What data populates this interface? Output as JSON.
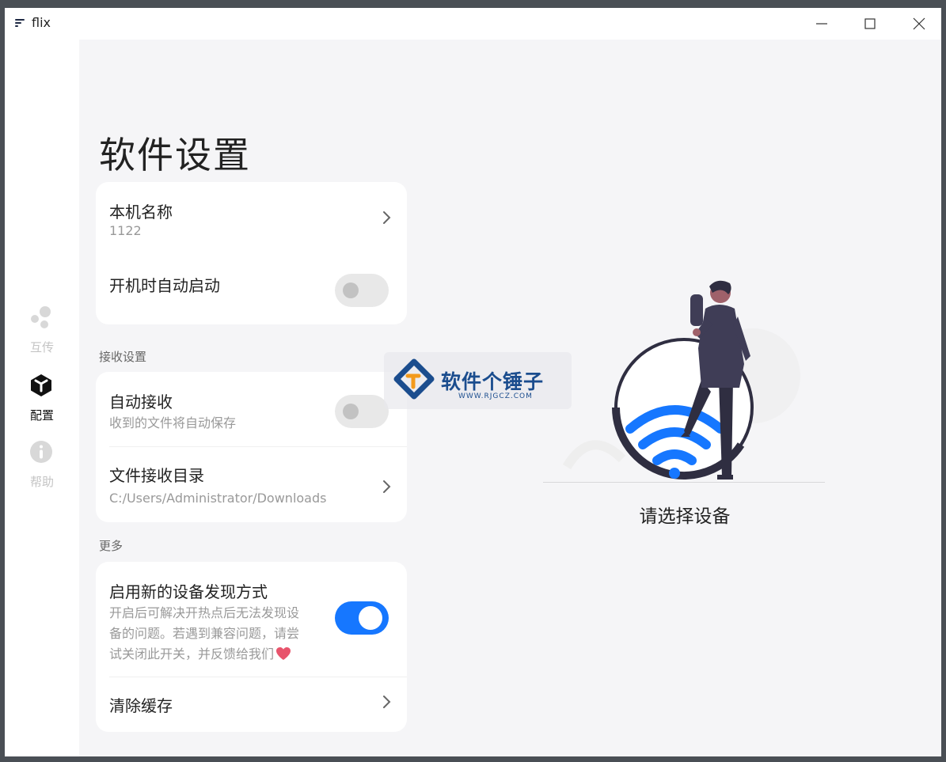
{
  "window": {
    "title": "flix"
  },
  "sidebar": {
    "items": [
      {
        "label": "互传",
        "icon": "share-dots-icon",
        "active": false
      },
      {
        "label": "配置",
        "icon": "config-cube-icon",
        "active": true
      },
      {
        "label": "帮助",
        "icon": "info-icon",
        "active": false
      }
    ]
  },
  "page": {
    "title": "软件设置"
  },
  "cards": {
    "device_name": {
      "title": "本机名称",
      "value": "1122"
    },
    "autostart": {
      "title": "开机时自动启动",
      "enabled": false
    },
    "receive_section": "接收设置",
    "auto_receive": {
      "title": "自动接收",
      "subtitle": "收到的文件将自动保存",
      "enabled": false
    },
    "receive_dir": {
      "title": "文件接收目录",
      "value": "C:/Users/Administrator/Downloads"
    },
    "more_section": "更多",
    "new_discovery": {
      "title": "启用新的设备发现方式",
      "desc_line1": "开启后可解决开热点后无法发现设",
      "desc_line2": "备的问题。若遇到兼容问题，请尝",
      "desc_line3": "试关闭此开关，并反馈给我们",
      "enabled": true
    },
    "clear_cache": {
      "title": "清除缓存"
    }
  },
  "right_panel": {
    "message": "请选择设备"
  },
  "watermark": {
    "name": "软件个锤子",
    "url": "WWW.RJGCZ.COM"
  },
  "colors": {
    "accent": "#1677ff",
    "sidebar_bg": "#ffffff",
    "main_bg": "#f5f5f7",
    "heart": "#e8546c"
  }
}
